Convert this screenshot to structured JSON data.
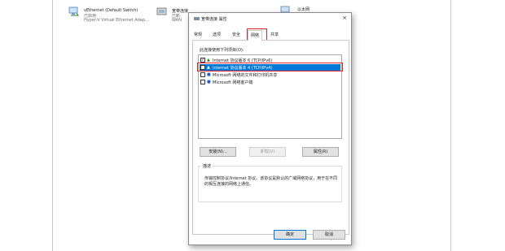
{
  "background": {
    "connections": [
      {
        "name": "vEthernet (Default Switch)",
        "status": "已启用",
        "device": "Hyper-V Virtual Ethernet Adap..."
      },
      {
        "name": "宽带连接",
        "status": "已断",
        "device": "WAN"
      },
      {
        "name": "以太网",
        "status": "",
        "device": ""
      }
    ]
  },
  "dialog": {
    "title": "宽带连接 属性",
    "close_glyph": "×",
    "tabs": [
      "常规",
      "选项",
      "安全",
      "网络",
      "共享"
    ],
    "active_tab": "网络",
    "items_label": "此连接使用下列项目(O):",
    "items": [
      {
        "label": "Internet 协议版本 6 (TCP/IPv6)",
        "checked": true,
        "icon": "network-protocol-icon",
        "selected": false
      },
      {
        "label": "Internet 协议版本 4 (TCP/IPv4)",
        "checked": true,
        "icon": "network-protocol-icon",
        "selected": true
      },
      {
        "label": "Microsoft 网络的文件和打印机共享",
        "checked": false,
        "icon": "file-share-icon",
        "selected": false
      },
      {
        "label": "Microsoft 网络客户端",
        "checked": false,
        "icon": "network-client-icon",
        "selected": false
      }
    ],
    "install_label": "安装(N)...",
    "uninstall_label": "卸载(U)",
    "properties_label": "属性(R)",
    "description_title": "描述",
    "description_text": "传输控制协议/Internet 协议。该协议是默认的广域网络协议，用于在不同的相互连接的网络上通信。",
    "ok_label": "确定",
    "cancel_label": "取消",
    "check_glyph": "✓",
    "colors": {
      "highlight": "#e0242b",
      "selection": "#0078d7"
    }
  }
}
